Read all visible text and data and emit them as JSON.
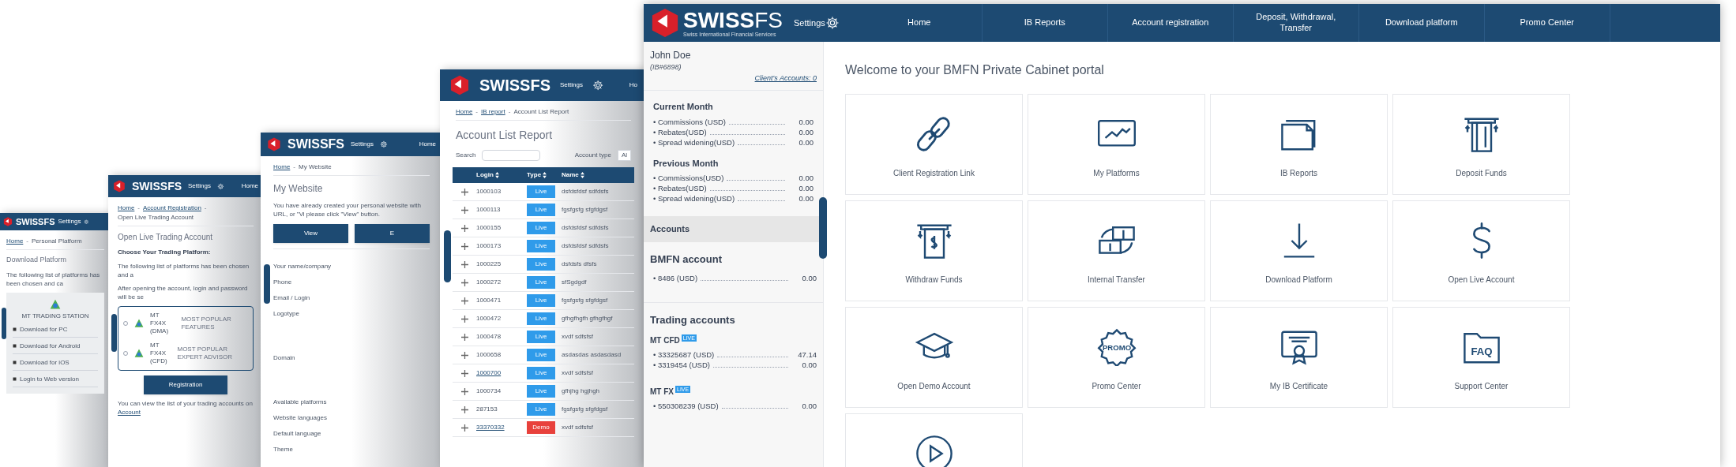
{
  "background_windows": [
    {
      "brand": "**SWISS**FS",
      "settings": "Settings",
      "separator": "-",
      "breadcrumb": [
        {
          "text": "Home",
          "link": true
        },
        {
          "text": "Personal Platform",
          "link": false
        }
      ],
      "title": "Download Platform",
      "blocks": [
        {
          "kind": "paragraph",
          "text": "The following list of platforms has been chosen and ca"
        },
        {
          "kind": "platform_box",
          "caption": "MT TRADING STATION",
          "items": [
            "Download for PC",
            "Download for Android",
            "Download for iOS",
            "Login to Web version"
          ]
        }
      ]
    },
    {
      "brand": "**SWISS**FS",
      "settings": "Settings",
      "nav": [
        "Home"
      ],
      "separator": "-",
      "breadcrumb": [
        {
          "text": "Home",
          "link": true
        },
        {
          "text": "Account Registration",
          "link": true
        },
        {
          "text": "Open Live Trading Account",
          "link": false
        }
      ],
      "title": "Open Live Trading Account",
      "blocks": [
        {
          "kind": "heading",
          "text": "Choose Your Trading Platform:"
        },
        {
          "kind": "paragraph",
          "text": "The following list of platforms has been chosen and a"
        },
        {
          "kind": "paragraph",
          "text": "After opening the account, login and password will be se"
        },
        {
          "kind": "options",
          "options": [
            {
              "label": "MT FX4X (DMA)",
              "desc": "MOST POPULAR FEATURES",
              "selected": false
            },
            {
              "label": "MT FX4X (CFD)",
              "desc": "MOST POPULAR EXPERT ADVISOR",
              "selected": false
            }
          ]
        },
        {
          "kind": "button",
          "text": "Registration"
        },
        {
          "kind": "paragraph",
          "text": "You can view the list of your trading accounts on",
          "link": "Account"
        }
      ]
    },
    {
      "brand": "**SWISS**FS",
      "settings": "Settings",
      "nav": [
        "Home"
      ],
      "separator": "-",
      "breadcrumb": [
        {
          "text": "Home",
          "link": true
        },
        {
          "text": "My Website",
          "link": false
        }
      ],
      "title": "My Website",
      "blocks": [
        {
          "kind": "paragraph",
          "text": "You have already created your personal website with URL, or \"Vi please click \"View\" button."
        },
        {
          "kind": "buttons",
          "buttons": [
            "View",
            "E"
          ]
        },
        {
          "kind": "fields",
          "fields": [
            {
              "label": "Your name/company",
              "tall": false
            },
            {
              "label": "Phone",
              "tall": false
            },
            {
              "label": "Email / Login",
              "tall": false
            },
            {
              "label": "Logotype",
              "tall": true
            },
            {
              "label": "Domain",
              "tall": true
            },
            {
              "label": "Available platforms",
              "tall": false
            },
            {
              "label": "Website languages",
              "tall": false
            },
            {
              "label": "Default language",
              "tall": false
            },
            {
              "label": "Theme",
              "tall": false
            }
          ]
        }
      ]
    },
    {
      "brand": "**SWISS**FS",
      "settings": "Settings",
      "nav": [
        "Ho"
      ],
      "separator": "-",
      "breadcrumb": [
        {
          "text": "Home",
          "link": true
        },
        {
          "text": "IB report",
          "link": true
        },
        {
          "text": "Account List Report",
          "link": false
        }
      ],
      "title": "Account List Report",
      "blocks": [
        {
          "kind": "search",
          "label": "Search",
          "filter_label": "Account type",
          "filter_value": "Al"
        },
        {
          "kind": "table",
          "columns": [
            "Login",
            "Type",
            "Name"
          ],
          "rows": [
            {
              "login": "1000103",
              "link": false,
              "type": "Live",
              "color": "#2f9bea",
              "name": "dsfdsfdsf sdfdsfs"
            },
            {
              "login": "1000113",
              "link": false,
              "type": "Live",
              "color": "#2f9bea",
              "name": "fgsfgsfg sfgfdgsf"
            },
            {
              "login": "1000155",
              "link": false,
              "type": "Live",
              "color": "#2f9bea",
              "name": "dsfdsfdsf sdfdsfs"
            },
            {
              "login": "1000173",
              "link": false,
              "type": "Live",
              "color": "#2f9bea",
              "name": "dsfdsfdsf sdfdsfs"
            },
            {
              "login": "1000225",
              "link": false,
              "type": "Live",
              "color": "#2f9bea",
              "name": "dsfdsfs dfsfs"
            },
            {
              "login": "1000272",
              "link": false,
              "type": "Live",
              "color": "#2f9bea",
              "name": "sfSgdgdf"
            },
            {
              "login": "1000471",
              "link": false,
              "type": "Live",
              "color": "#2f9bea",
              "name": "fgsfgsfg sfgfdgsf"
            },
            {
              "login": "1000472",
              "link": false,
              "type": "Live",
              "color": "#2f9bea",
              "name": "gfhgfhgfh gfhgfhgf"
            },
            {
              "login": "1000478",
              "link": false,
              "type": "Live",
              "color": "#2f9bea",
              "name": "xvdf sdfsfsf"
            },
            {
              "login": "1000658",
              "link": false,
              "type": "Live",
              "color": "#2f9bea",
              "name": "asdasdas asdasdasd"
            },
            {
              "login": "1000700",
              "link": true,
              "type": "Live",
              "color": "#2f9bea",
              "name": "xvdf sdfsfsf"
            },
            {
              "login": "1000734",
              "link": false,
              "type": "Live",
              "color": "#2f9bea",
              "name": "gfhjhg hgjhgh"
            },
            {
              "login": "287153",
              "link": false,
              "type": "Live",
              "color": "#2f9bea",
              "name": "fgsfgsfg sfgfdgsf"
            },
            {
              "login": "33370332",
              "link": true,
              "type": "Demo",
              "color": "#e8413c",
              "name": "xvdf sdfsfsf"
            }
          ]
        }
      ]
    }
  ],
  "window": {
    "brand": "**SWISS**FS",
    "brand_subtitle": "Swiss International Financial Services",
    "settings": "Settings",
    "nav": [
      "Home",
      "IB Reports",
      "Account registration",
      "Deposit, Withdrawal, Transfer",
      "Download platform",
      "Promo Center"
    ]
  },
  "sidebar": {
    "user": "John Doe",
    "ib": "(IB#6898)",
    "clients_link": "Client's Accounts: 0",
    "groups": [
      {
        "title": "Current Month",
        "rows": [
          {
            "label": "• Commissions (USD)",
            "value": "0.00"
          },
          {
            "label": "• Rebates(USD)",
            "value": "0.00"
          },
          {
            "label": "• Spread widening(USD)",
            "value": "0.00"
          }
        ]
      },
      {
        "title": "Previous Month",
        "rows": [
          {
            "label": "• Commissions(USD)",
            "value": "0.00"
          },
          {
            "label": "• Rebates(USD)",
            "value": "0.00"
          },
          {
            "label": "• Spread widening(USD)",
            "value": "0.00"
          }
        ]
      }
    ],
    "accounts_header": "Accounts",
    "sections": [
      {
        "title": "BMFN account",
        "subgroups": [
          {
            "rows": [
              {
                "label": "• 8486 (USD)",
                "value": "0.00"
              }
            ]
          }
        ]
      },
      {
        "title": "Trading accounts",
        "subgroups": [
          {
            "name": "MT CFD",
            "badge": "LIVE",
            "rows": [
              {
                "label": "• 33325687 (USD)",
                "value": "47.14"
              },
              {
                "label": "• 3319454 (USD)",
                "value": "0.00"
              }
            ]
          },
          {
            "name": "MT FX",
            "badge": "LIVE",
            "rows": [
              {
                "label": "• 550308239 (USD)",
                "value": "0.00"
              }
            ]
          }
        ]
      }
    ]
  },
  "content": {
    "title": "Welcome to your BMFN Private Cabinet portal",
    "tiles": [
      {
        "kind": "link",
        "label": "Client Registration Link"
      },
      {
        "kind": "chart",
        "label": "My Platforms"
      },
      {
        "kind": "documents",
        "label": "IB Reports"
      },
      {
        "kind": "atm",
        "label": "Deposit Funds"
      },
      {
        "kind": "withdraw",
        "label": "Withdraw Funds"
      },
      {
        "kind": "transfer",
        "label": "Internal Transfer"
      },
      {
        "kind": "download",
        "label": "Download Platform"
      },
      {
        "kind": "dollar",
        "label": "Open Live Account"
      },
      {
        "kind": "cap",
        "label": "Open Demo Account"
      },
      {
        "kind": "promo",
        "icon_text": "PROMO",
        "label": "Promo Center"
      },
      {
        "kind": "certificate",
        "label": "My IB Certificate"
      },
      {
        "kind": "folder",
        "icon_text": "FAQ",
        "label": "Support Center"
      },
      {
        "kind": "play"
      }
    ]
  }
}
